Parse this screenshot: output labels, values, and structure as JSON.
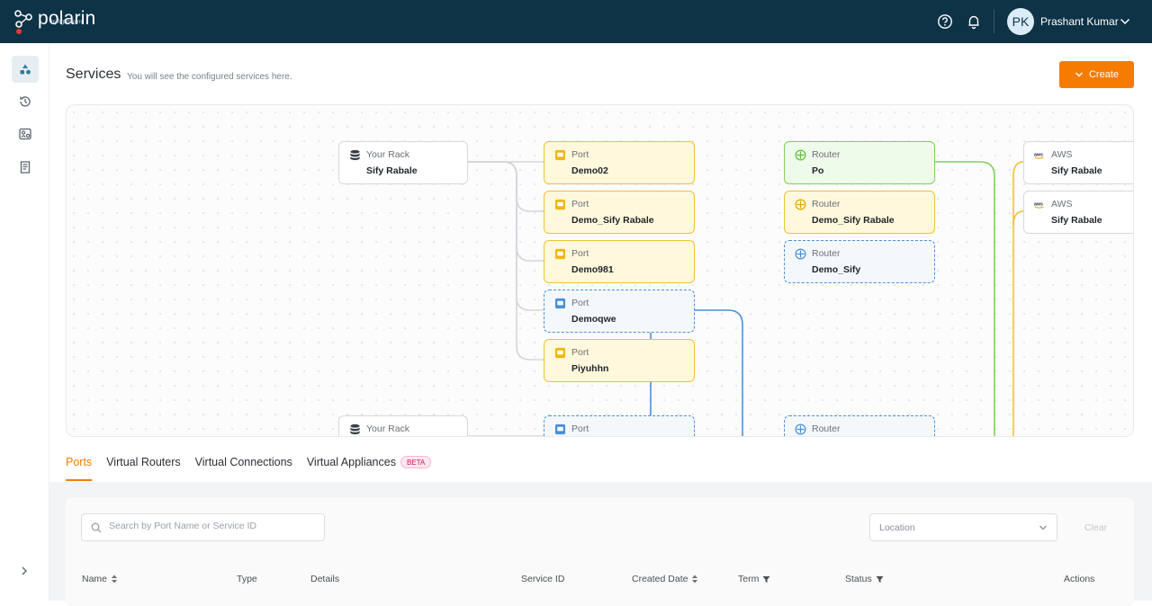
{
  "app": {
    "brand": "polarin",
    "brand_sub": "by lightstorm"
  },
  "topbar": {
    "help_icon": "help-circle-icon",
    "bell_icon": "bell-icon",
    "user_initials": "PK",
    "user_name": "Prashant Kumar"
  },
  "sidebar": {
    "items": [
      {
        "name": "services",
        "icon": "services-icon",
        "active": true
      },
      {
        "name": "history",
        "icon": "history-icon",
        "active": false
      },
      {
        "name": "monitoring",
        "icon": "monitoring-icon",
        "active": false
      },
      {
        "name": "billing",
        "icon": "document-icon",
        "active": false
      }
    ],
    "expand_icon": "chevron-right-icon"
  },
  "header": {
    "title": "Services",
    "subtitle": "You will see the configured services here.",
    "create_label": "Create"
  },
  "canvas": {
    "nodes": [
      {
        "kind": "rack",
        "type": "Your Rack",
        "name": "Sify Rabale"
      },
      {
        "kind": "port",
        "type": "Port",
        "name": "Demo02"
      },
      {
        "kind": "port",
        "type": "Port",
        "name": "Demo_Sify Rabale"
      },
      {
        "kind": "port",
        "type": "Port",
        "name": "Demo981"
      },
      {
        "kind": "port-pending",
        "type": "Port",
        "name": "Demoqwe"
      },
      {
        "kind": "port",
        "type": "Port",
        "name": "Piyuhhn"
      },
      {
        "kind": "router-active",
        "type": "Router",
        "name": "Po"
      },
      {
        "kind": "router",
        "type": "Router",
        "name": "Demo_Sify Rabale"
      },
      {
        "kind": "router-pending",
        "type": "Router",
        "name": "Demo_Sify"
      },
      {
        "kind": "cloud",
        "type": "AWS",
        "name": "Sify Rabale"
      },
      {
        "kind": "cloud",
        "type": "AWS",
        "name": "Sify Rabale"
      },
      {
        "kind": "rack",
        "type": "Your Rack",
        "name": ""
      },
      {
        "kind": "port-pending",
        "type": "Port",
        "name": ""
      },
      {
        "kind": "router-pending",
        "type": "Router",
        "name": ""
      }
    ]
  },
  "tabs": [
    {
      "label": "Ports",
      "active": true
    },
    {
      "label": "Virtual Routers",
      "active": false
    },
    {
      "label": "Virtual Connections",
      "active": false
    },
    {
      "label": "Virtual Appliances",
      "active": false,
      "badge": "BETA"
    }
  ],
  "filters": {
    "search_placeholder": "Search by Port Name or Service ID",
    "location_placeholder": "Location",
    "clear_label": "Clear"
  },
  "table": {
    "columns": [
      "Name",
      "Type",
      "Details",
      "Service ID",
      "Created Date",
      "Term",
      "Status",
      "Actions"
    ]
  },
  "colors": {
    "topbar": "#0e3347",
    "accent": "#f57c00",
    "port": "#f1c232",
    "pending": "#4a90d9",
    "active": "#7ed05a"
  }
}
